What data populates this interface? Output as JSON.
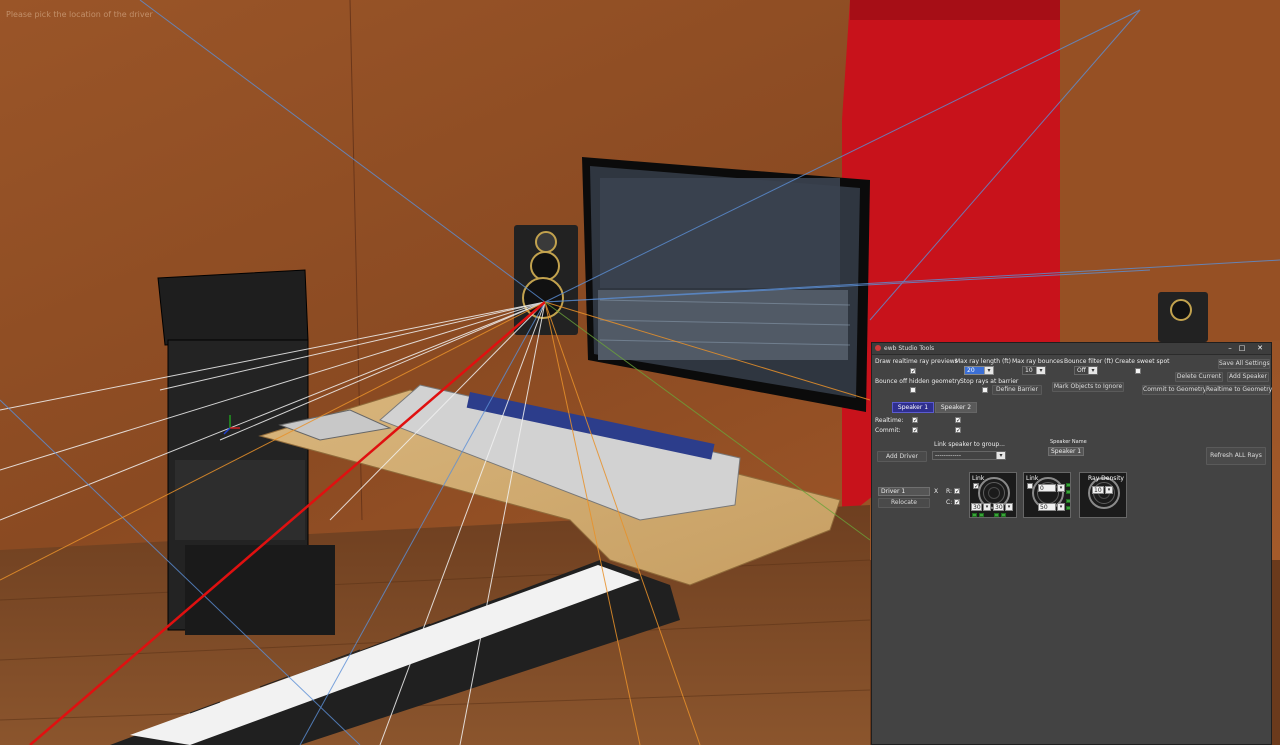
{
  "viewport": {
    "status_text": "Please pick the location of the driver"
  },
  "tools_window": {
    "title": "ewb Studio Tools",
    "controls": {
      "minimize": "–",
      "maximize": "□",
      "close": "✕"
    },
    "top": {
      "draw_previews_label": "Draw realtime ray previews",
      "draw_previews_checked": "✓",
      "max_ray_length_label": "Max ray length (ft)",
      "max_ray_length_value": "20",
      "max_ray_bounces_label": "Max ray bounces",
      "max_ray_bounces_value": "10",
      "bounce_filter_label": "Bounce filter (ft)",
      "bounce_filter_value": "Off",
      "create_sweet_spot_label": "Create sweet spot",
      "create_sweet_spot_checked": "",
      "bounce_hidden_label": "Bounce off hidden geometry",
      "bounce_hidden_checked": "",
      "stop_rays_label": "Stop rays at barrier",
      "stop_rays_checked": "",
      "define_barrier_button": "Define Barrier",
      "mark_objects_button": "Mark Objects to Ignore",
      "save_all_button": "Save All Settings",
      "delete_current_button": "Delete Current",
      "add_speaker_button": "Add Speaker",
      "commit_geometry_button": "Commit to Geometry",
      "realtime_geometry_button": "Realtime to Geometry"
    },
    "tabs": [
      "Speaker 1",
      "Speaker 2"
    ],
    "realtime_label": "Realtime:",
    "commit_label": "Commit:",
    "speaker1_realtime": "✓",
    "speaker1_commit": "✓",
    "speaker2_realtime": "✓",
    "speaker2_commit": "✓",
    "add_driver_button": "Add Driver",
    "link_group_label": "Link speaker to group...",
    "link_group_value": "------------",
    "speaker_name_label": "Speaker Name",
    "speaker_name_value": "Speaker 1",
    "refresh_button": "Refresh ALL Rays",
    "driver": {
      "name": "Driver 1",
      "remove": "X",
      "r_label": "R:",
      "c_label": "C:",
      "r_checked": "✓",
      "c_checked": "✓",
      "relocate_button": "Relocate"
    },
    "dials": {
      "d1_label": "Link",
      "d1_checked": "✓",
      "d1_a": "30",
      "d1_b": "30",
      "d2_label": "Link",
      "d2_a": "0",
      "d2_b": "50",
      "d3_label": "Ray Density",
      "d3_value": "10"
    }
  },
  "colors": {
    "wall": "#8a4a22",
    "floor": "#7a4a26",
    "accent_red": "#c8121b",
    "panel": "#434343",
    "tab_active": "#2f2f8f"
  }
}
